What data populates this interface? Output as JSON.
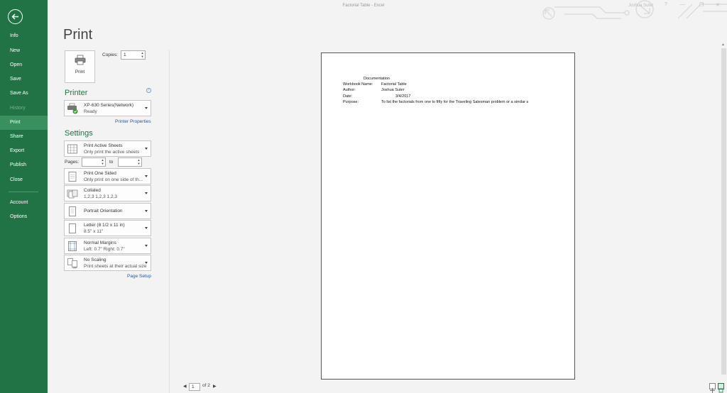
{
  "window": {
    "title": "Factorial Table - Excel",
    "user": "Joshua Suter"
  },
  "nav": {
    "items": [
      {
        "label": "Info"
      },
      {
        "label": "New"
      },
      {
        "label": "Open"
      },
      {
        "label": "Save"
      },
      {
        "label": "Save As"
      },
      {
        "label": "History"
      },
      {
        "label": "Print"
      },
      {
        "label": "Share"
      },
      {
        "label": "Export"
      },
      {
        "label": "Publish"
      },
      {
        "label": "Close"
      },
      {
        "label": "Account"
      },
      {
        "label": "Options"
      }
    ]
  },
  "page_title": "Print",
  "print_button": {
    "label": "Print"
  },
  "copies": {
    "label": "Copies:",
    "value": "1"
  },
  "printer": {
    "heading": "Printer",
    "name": "XP-630 Series(Network)",
    "status": "Ready",
    "properties_link": "Printer Properties"
  },
  "settings": {
    "heading": "Settings",
    "what": {
      "title": "Print Active Sheets",
      "sub": "Only print the active sheets"
    },
    "pages": {
      "label": "Pages:",
      "to_label": "to",
      "from_value": "",
      "to_value": ""
    },
    "sides": {
      "title": "Print One Sided",
      "sub": "Only print on one side of th..."
    },
    "collation": {
      "title": "Collated",
      "sub": "1,2,3    1,2,3    1,2,3"
    },
    "orientation": {
      "title": "Portrait Orientation"
    },
    "paper": {
      "title": "Letter (8 1/2 x 11 in)",
      "sub": "8.5\" x 11\""
    },
    "margins": {
      "title": "Normal Margins",
      "sub": "Left:  0.7\"    Right:  0.7\""
    },
    "scaling": {
      "title": "No Scaling",
      "sub": "Print sheets at their actual size"
    },
    "page_setup_link": "Page Setup"
  },
  "preview": {
    "heading": "Documentation",
    "rows": [
      {
        "label": "Workbook Name:",
        "value": "Factorial Table"
      },
      {
        "label": "Author:",
        "value": "Joshua Suter"
      },
      {
        "label": "Date:",
        "value": "3/4/2017"
      },
      {
        "label": "Purpose:",
        "value": "To list the factorials from one to fifty for the Traveling Salesman problem or a similar s"
      }
    ]
  },
  "page_nav": {
    "current": "1",
    "total_label": "of 2"
  },
  "colors": {
    "accent": "#217346",
    "link": "#2b579a"
  }
}
